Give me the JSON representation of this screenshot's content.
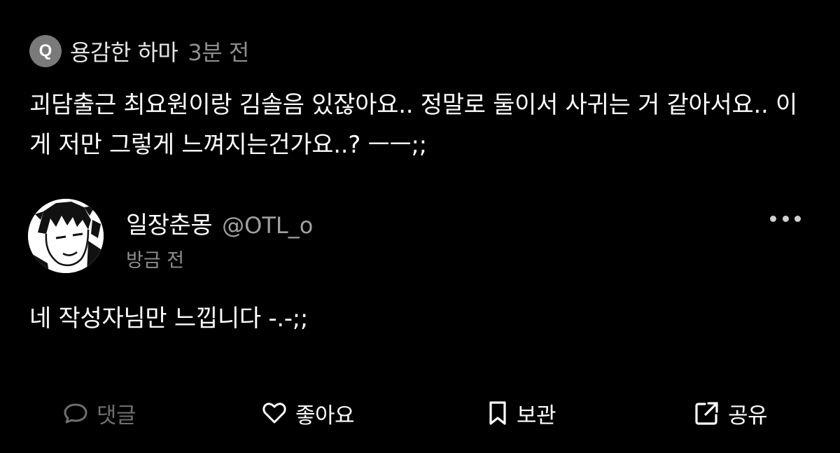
{
  "question": {
    "badge_letter": "Q",
    "asker_name": "용감한 하마",
    "time": "3분 전",
    "text": "괴담출근 최요원이랑 김솔음 있잖아요.. 정말로 둘이서 사귀는 거 같아서요.. 이게 저만 그렇게 느껴지는건가요..? ㅡㅡ;;"
  },
  "answer": {
    "author_name": "일장춘몽",
    "author_handle": "@OTL_o",
    "time": "방금 전",
    "text": "네 작성자님만 느낍니다 -.-;;"
  },
  "actions": {
    "comment_label": "댓글",
    "like_label": "좋아요",
    "save_label": "보관",
    "share_label": "공유"
  },
  "icons": {
    "more": "more-horizontal-icon",
    "comment": "speech-bubble-icon",
    "like": "heart-outline-icon",
    "save": "bookmark-outline-icon",
    "share": "share-external-icon"
  },
  "colors": {
    "background": "#000000",
    "text_primary": "#ffffff",
    "text_secondary": "#8e8e8e",
    "disabled": "#6e6e6e",
    "badge": "#7a7a7a"
  }
}
